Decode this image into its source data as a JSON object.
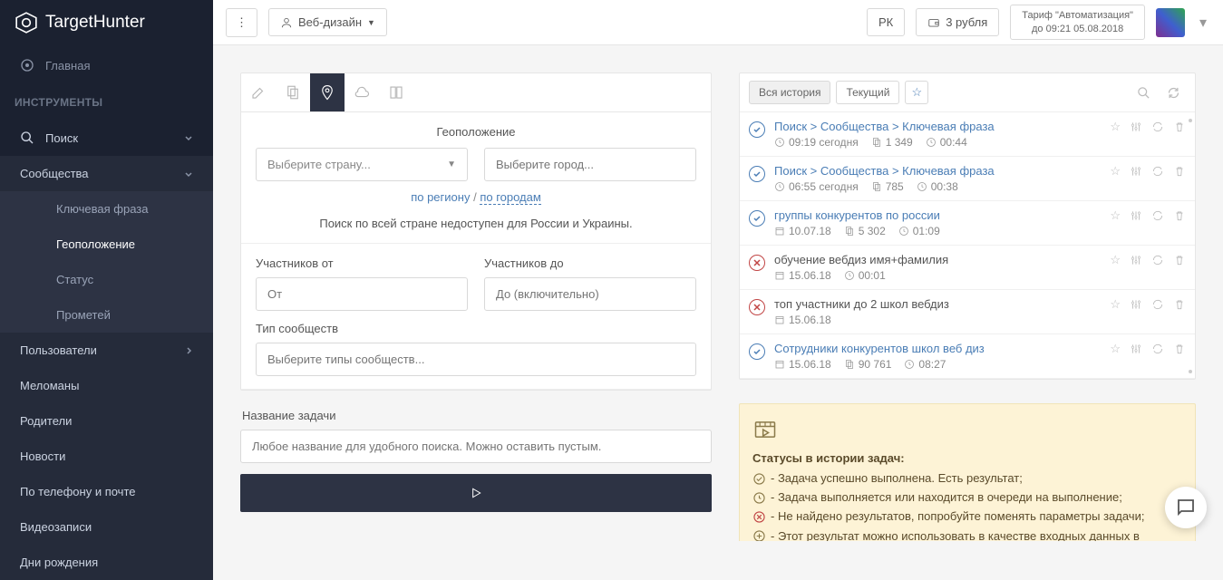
{
  "brand": {
    "name1": "Target",
    "name2": "Hunter"
  },
  "sidebar": {
    "home": "Главная",
    "section": "ИНСТРУМЕНТЫ",
    "search": "Поиск",
    "communities": "Сообщества",
    "leafs": [
      "Ключевая фраза",
      "Геоположение",
      "Статус",
      "Прометей"
    ],
    "items": [
      "Пользователи",
      "Меломаны",
      "Родители",
      "Новости",
      "По телефону и почте",
      "Видеозаписи",
      "Дни рождения"
    ]
  },
  "topbar": {
    "project": "Веб-дизайн",
    "rk": "РК",
    "balance": "3 рубля",
    "tariff1": "Тариф \"Автоматизация\"",
    "tariff2": "до 09:21 05.08.2018"
  },
  "form": {
    "geo_title": "Геоположение",
    "country": "Выберите страну...",
    "city": "Выберите город...",
    "by_region": "по региону",
    "by_cities": "по городам",
    "note": "Поиск по всей стране недоступен для России и Украины.",
    "members_from": "Участников от",
    "members_to": "Участников до",
    "from": "От",
    "to": "До (включительно)",
    "type_label": "Тип сообществ",
    "type_ph": "Выберите типы сообществ...",
    "task_label": "Название задачи",
    "task_ph": "Любое название для удобного поиска. Можно оставить пустым."
  },
  "history": {
    "all": "Вся история",
    "current": "Текущий",
    "items": [
      {
        "status": "ok",
        "title": "Поиск > Сообщества > Ключевая фраза",
        "link": true,
        "meta": [
          {
            "t": "clock",
            "v": "09:19 сегодня"
          },
          {
            "t": "doc",
            "v": "1 349"
          },
          {
            "t": "dur",
            "v": "00:44"
          }
        ]
      },
      {
        "status": "ok",
        "title": "Поиск > Сообщества > Ключевая фраза",
        "link": true,
        "meta": [
          {
            "t": "clock",
            "v": "06:55 сегодня"
          },
          {
            "t": "doc",
            "v": "785"
          },
          {
            "t": "dur",
            "v": "00:38"
          }
        ]
      },
      {
        "status": "ok",
        "title": "группы конкурентов по россии",
        "link": true,
        "meta": [
          {
            "t": "cal",
            "v": "10.07.18"
          },
          {
            "t": "doc",
            "v": "5 302"
          },
          {
            "t": "dur",
            "v": "01:09"
          }
        ]
      },
      {
        "status": "err",
        "title": "обучение вебдиз имя+фамилия",
        "link": false,
        "meta": [
          {
            "t": "cal",
            "v": "15.06.18"
          },
          {
            "t": "dur",
            "v": "00:01"
          }
        ]
      },
      {
        "status": "err",
        "title": "топ участники до 2 школ вебдиз",
        "link": false,
        "meta": [
          {
            "t": "cal",
            "v": "15.06.18"
          }
        ]
      },
      {
        "status": "ok",
        "title": "Сотрудники конкурентов школ веб диз",
        "link": true,
        "meta": [
          {
            "t": "cal",
            "v": "15.06.18"
          },
          {
            "t": "doc",
            "v": "90 761"
          },
          {
            "t": "dur",
            "v": "08:27"
          }
        ]
      }
    ]
  },
  "info": {
    "title": "Статусы в истории задач:",
    "lines": [
      {
        "ico": "ok",
        "txt": "- Задача успешно выполнена. Есть результат;"
      },
      {
        "ico": "wait",
        "txt": "- Задача выполняется или находится в очереди на выполнение;"
      },
      {
        "ico": "err",
        "txt": "- Не найдено результатов, попробуйте поменять параметры задачи;"
      },
      {
        "ico": "plus",
        "txt": "- Этот результат можно использовать в качестве входных данных в текущем"
      }
    ]
  }
}
